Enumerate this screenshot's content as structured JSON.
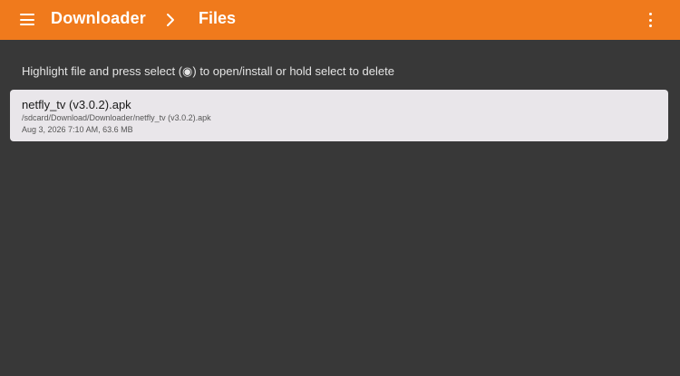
{
  "app": {
    "title": "Downloader",
    "page_title": "Files",
    "accent_color": "#f07a1c",
    "background_color": "#383838"
  },
  "icons": {
    "menu": "hamburger-menu-icon",
    "breadcrumb_separator": "chevron-right-icon",
    "overflow": "more-vert-icon"
  },
  "instructions": "Highlight file and press select (◉) to open/install or hold select to delete",
  "files": [
    {
      "name": "netfly_tv (v3.0.2).apk",
      "path": "/sdcard/Download/Downloader/netfly_tv (v3.0.2).apk",
      "meta": "Aug 3, 2026 7:10 AM, 63.6 MB"
    }
  ]
}
